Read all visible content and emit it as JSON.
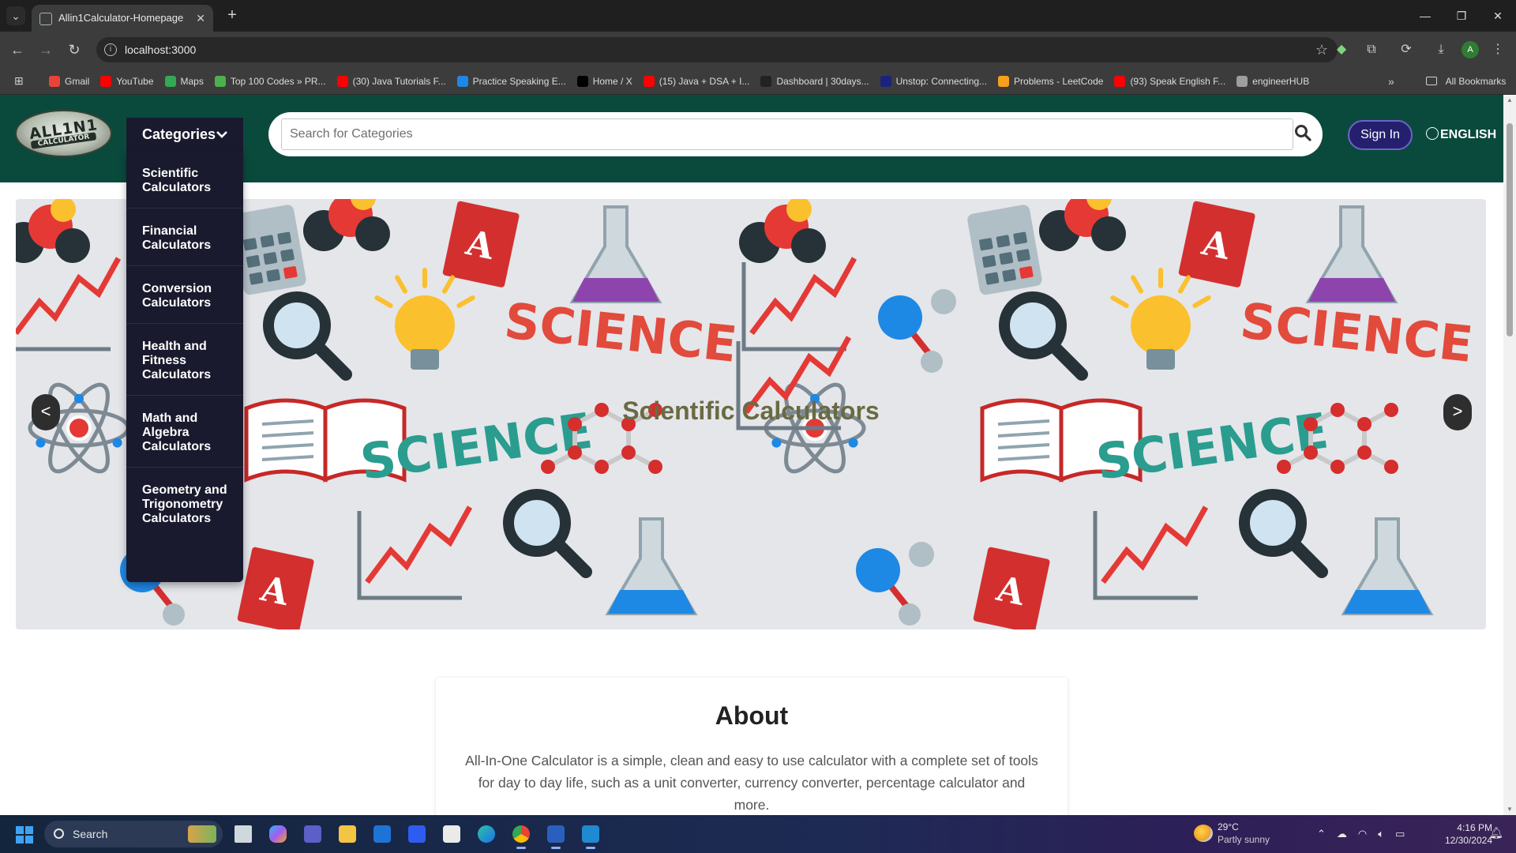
{
  "browser": {
    "tab_title": "Allin1Calculator-Homepage",
    "url": "localhost:3000",
    "profile_initial": "A",
    "bookmarks": [
      {
        "label": "Gmail",
        "color": "#ea4335"
      },
      {
        "label": "YouTube",
        "color": "#ff0000"
      },
      {
        "label": "Maps",
        "color": "#34a853"
      },
      {
        "label": "Top 100 Codes » PR...",
        "color": "#4caf50"
      },
      {
        "label": "(30) Java Tutorials F...",
        "color": "#ff0000"
      },
      {
        "label": "Practice Speaking E...",
        "color": "#1e88e5"
      },
      {
        "label": "Home / X",
        "color": "#000000"
      },
      {
        "label": "(15) Java + DSA + I...",
        "color": "#ff0000"
      },
      {
        "label": "Dashboard | 30days...",
        "color": "#222222"
      },
      {
        "label": "Unstop: Connecting...",
        "color": "#1a237e"
      },
      {
        "label": "Problems - LeetCode",
        "color": "#f89f1b"
      },
      {
        "label": "(93) Speak English F...",
        "color": "#ff0000"
      },
      {
        "label": "engineerHUB",
        "color": "#9e9e9e"
      }
    ],
    "all_bookmarks": "All Bookmarks"
  },
  "header": {
    "logo_text_top": "ALL1N1",
    "logo_text_bottom": "CALCULATOR",
    "categories_label": "Categories",
    "search_placeholder": "Search for Categories",
    "signin_label": "Sign In",
    "language_label": "ENGLISH"
  },
  "categories_menu": [
    "Scientific Calculators",
    "Financial Calculators",
    "Conversion Calculators",
    "Health and Fitness Calculators",
    "Math and Algebra Calculators",
    "Geometry and Trigonometry Calculators"
  ],
  "banner": {
    "title": "Scientific Calculators",
    "prev_label": "<",
    "next_label": ">",
    "science_word": "SCIENCE",
    "book_letter": "A"
  },
  "about": {
    "title": "About",
    "text": "All-In-One Calculator is a simple, clean and easy to use calculator with a complete set of tools for day to day life, such as a unit converter, currency converter, percentage calculator and more."
  },
  "taskbar": {
    "search_label": "Search",
    "weather_temp": "29°C",
    "weather_desc": "Partly sunny",
    "time": "4:16 PM",
    "date": "12/30/2024"
  }
}
